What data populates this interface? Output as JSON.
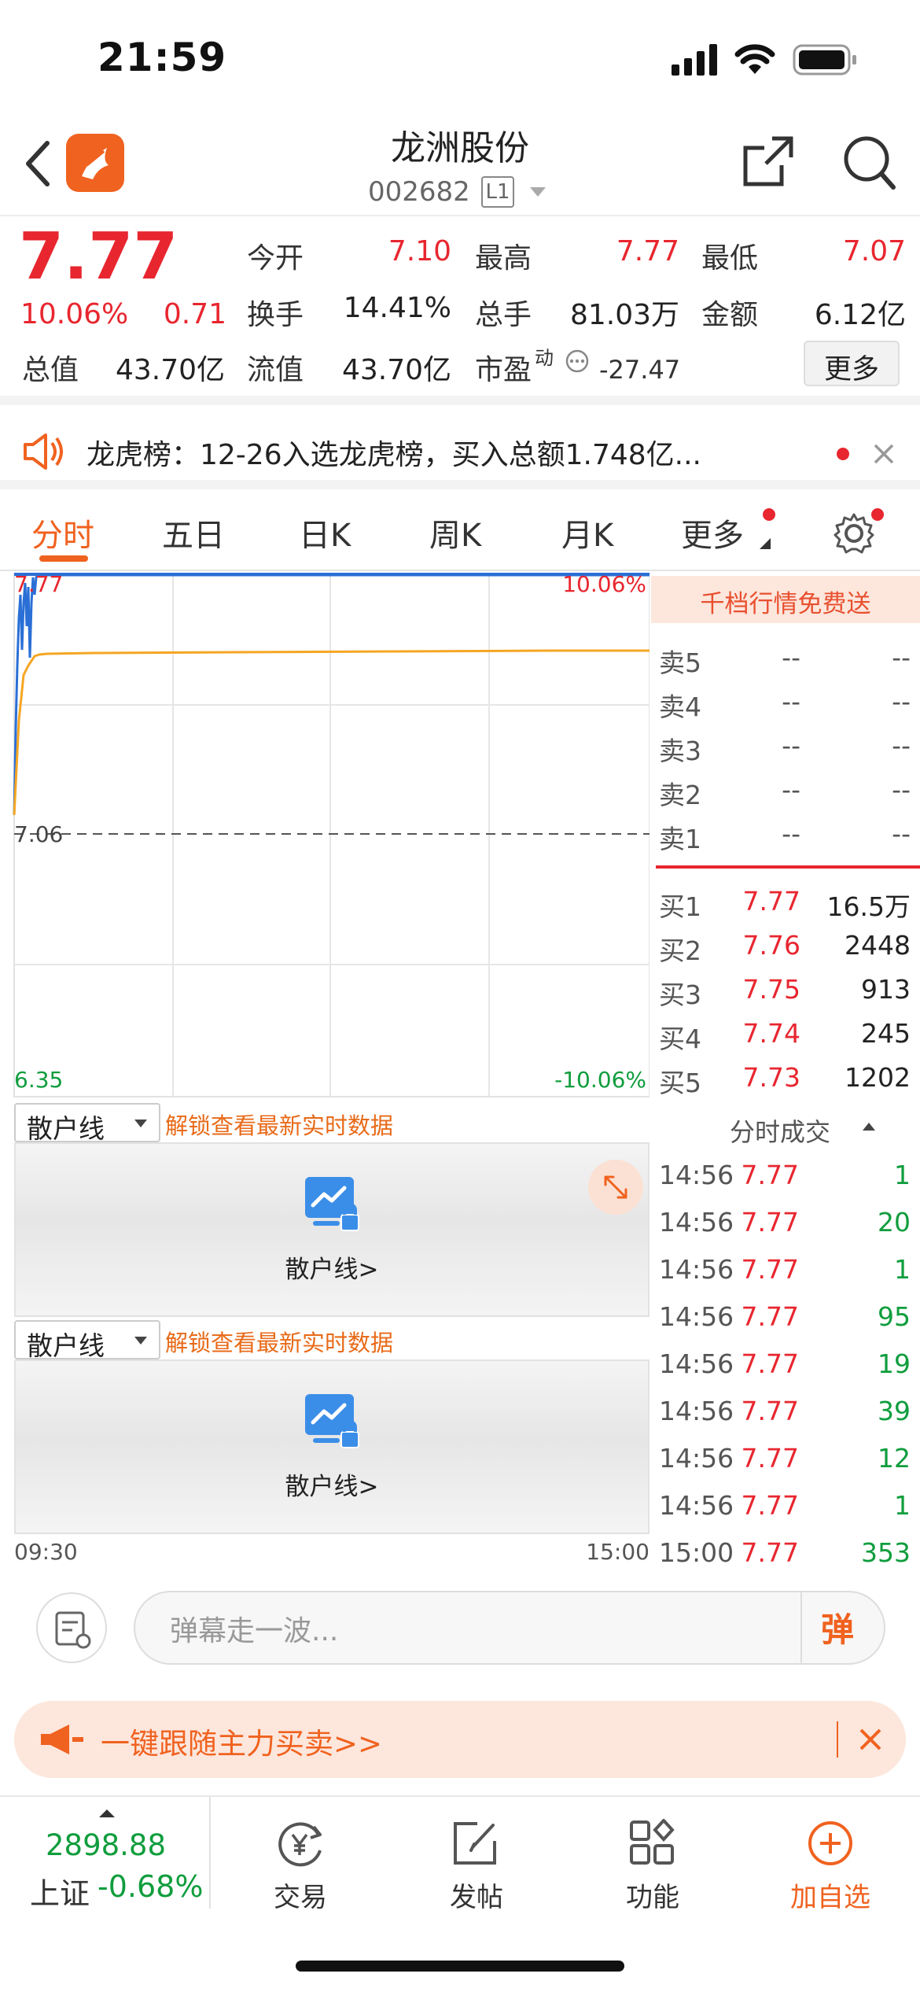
{
  "status_bar": {
    "time": "21:59"
  },
  "header": {
    "title": "龙洲股份",
    "code": "002682",
    "level": "L1"
  },
  "quote": {
    "price": "7.77",
    "change_pct": "10.06%",
    "change_amt": "0.71",
    "fields": {
      "open_label": "今开",
      "open": "7.10",
      "high_label": "最高",
      "high": "7.77",
      "low_label": "最低",
      "low": "7.07",
      "turnover_label": "换手",
      "turnover": "14.41%",
      "volume_label": "总手",
      "volume": "81.03万",
      "amount_label": "金额",
      "amount": "6.12亿",
      "total_cap_label": "总值",
      "total_cap": "43.70亿",
      "float_cap_label": "流值",
      "float_cap": "43.70亿",
      "pe_label": "市盈",
      "pe_sup": "动",
      "pe": "-27.47"
    },
    "more_button": "更多"
  },
  "notice": {
    "text": "龙虎榜：12-26入选龙虎榜，买入总额1.748亿..."
  },
  "tabs": [
    "分时",
    "五日",
    "日K",
    "周K",
    "月K",
    "更多"
  ],
  "chart": {
    "top_price": "7.77",
    "top_pct": "10.06%",
    "mid_price": "7.06",
    "bottom_price": "6.35",
    "bottom_pct": "-10.06%",
    "start_time": "09:30",
    "end_time": "15:00"
  },
  "subcharts": [
    {
      "select": "散户线",
      "unlock_text": "解锁查看最新实时数据",
      "label": "散户线>"
    },
    {
      "select": "散户线",
      "unlock_text": "解锁查看最新实时数据",
      "label": "散户线>"
    }
  ],
  "orderbook": {
    "promo": "千档行情免费送",
    "asks": [
      {
        "label": "卖5",
        "price": "--",
        "vol": "--"
      },
      {
        "label": "卖4",
        "price": "--",
        "vol": "--"
      },
      {
        "label": "卖3",
        "price": "--",
        "vol": "--"
      },
      {
        "label": "卖2",
        "price": "--",
        "vol": "--"
      },
      {
        "label": "卖1",
        "price": "--",
        "vol": "--"
      }
    ],
    "bids": [
      {
        "label": "买1",
        "price": "7.77",
        "vol": "16.5万"
      },
      {
        "label": "买2",
        "price": "7.76",
        "vol": "2448"
      },
      {
        "label": "买3",
        "price": "7.75",
        "vol": "913"
      },
      {
        "label": "买4",
        "price": "7.74",
        "vol": "245"
      },
      {
        "label": "买5",
        "price": "7.73",
        "vol": "1202"
      }
    ]
  },
  "trades": {
    "title": "分时成交",
    "rows": [
      {
        "time": "14:56",
        "price": "7.77",
        "vol": "1"
      },
      {
        "time": "14:56",
        "price": "7.77",
        "vol": "20"
      },
      {
        "time": "14:56",
        "price": "7.77",
        "vol": "1"
      },
      {
        "time": "14:56",
        "price": "7.77",
        "vol": "95"
      },
      {
        "time": "14:56",
        "price": "7.77",
        "vol": "19"
      },
      {
        "time": "14:56",
        "price": "7.77",
        "vol": "39"
      },
      {
        "time": "14:56",
        "price": "7.77",
        "vol": "12"
      },
      {
        "time": "14:56",
        "price": "7.77",
        "vol": "1"
      },
      {
        "time": "15:00",
        "price": "7.77",
        "vol": "353"
      }
    ]
  },
  "comment": {
    "placeholder": "弹幕走一波...",
    "danmu_button": "弹"
  },
  "banner": {
    "text": "一键跟随主力买卖>>"
  },
  "bottom_nav": {
    "index_value": "2898.88",
    "index_name": "上证",
    "index_change": "-0.68%",
    "items": [
      "交易",
      "发帖",
      "功能",
      "加自选"
    ]
  },
  "colors": {
    "accent": "#f0621f",
    "up": "#e8262f",
    "down": "#109d3d",
    "price_line": "#2a6fd6",
    "avg_line": "#f5a623"
  }
}
